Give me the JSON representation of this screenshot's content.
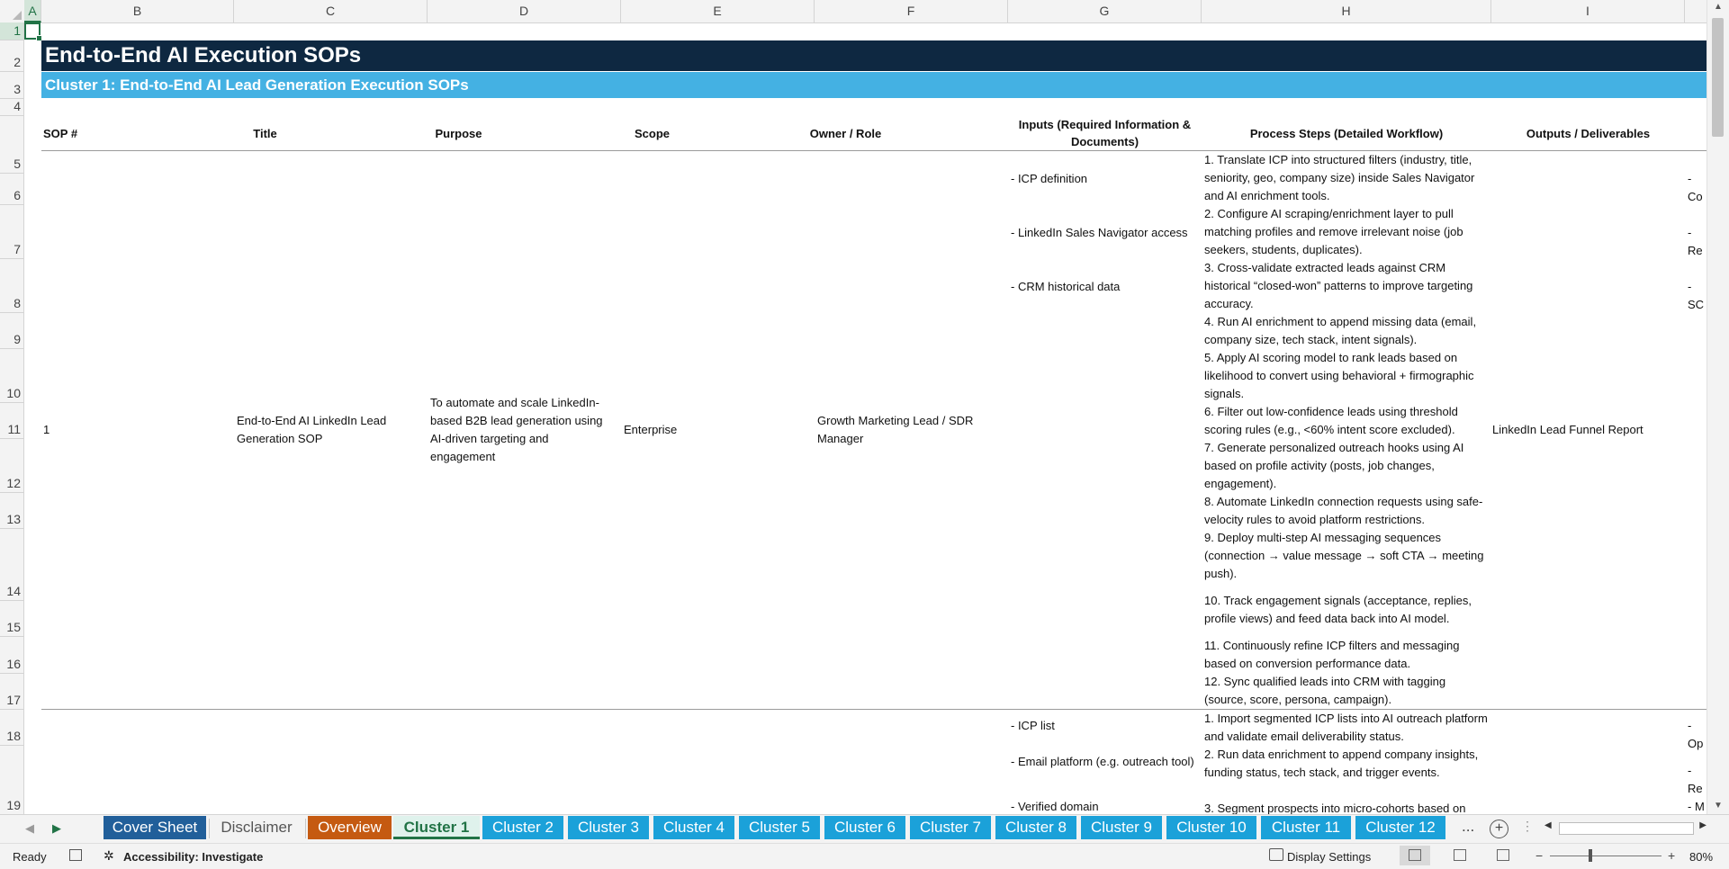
{
  "columns": [
    "A",
    "B",
    "C",
    "D",
    "E",
    "F",
    "G",
    "H",
    "I"
  ],
  "rows": [
    "1",
    "2",
    "3",
    "4",
    "5",
    "6",
    "7",
    "8",
    "9",
    "10",
    "11",
    "12",
    "13",
    "14",
    "15",
    "16",
    "17",
    "18",
    "19"
  ],
  "sheet": {
    "title": "End-to-End AI Execution SOPs",
    "subtitle": "Cluster 1: End-to-End AI Lead Generation Execution SOPs",
    "headers": {
      "sop": "SOP #",
      "title": "Title",
      "purpose": "Purpose",
      "scope": "Scope",
      "owner": "Owner / Role",
      "inputs": "Inputs (Required Information & Documents)",
      "process": "Process Steps (Detailed Workflow)",
      "outputs": "Outputs / Deliverables"
    },
    "record1": {
      "sop": "1",
      "title": "End-to-End AI LinkedIn Lead Generation SOP",
      "purpose": "To automate and scale LinkedIn-based B2B lead generation using AI-driven targeting and engagement",
      "scope": "Enterprise",
      "owner": "Growth Marketing Lead / SDR Manager",
      "inputs": [
        "- ICP definition",
        "- LinkedIn Sales Navigator access",
        "- CRM historical data"
      ],
      "steps": [
        "1. Translate ICP into structured filters (industry, title, seniority, geo, company size) inside Sales Navigator and AI enrichment tools.",
        "2. Configure AI scraping/enrichment layer to pull matching profiles and remove irrelevant noise (job seekers, students, duplicates).",
        "3. Cross-validate extracted leads against CRM historical “closed-won” patterns to improve targeting accuracy.",
        "4. Run AI enrichment to append missing data (email, company size, tech stack, intent signals).",
        "5. Apply AI scoring model to rank leads based on likelihood to convert using behavioral + firmographic signals.",
        "6. Filter out low-confidence leads using threshold scoring rules (e.g., <60% intent score excluded).",
        "7. Generate personalized outreach hooks using AI based on profile activity (posts, job changes, engagement).",
        "8. Automate LinkedIn connection requests using safe-velocity rules to avoid platform restrictions.",
        "9. Deploy multi-step AI messaging sequences (connection → value message → soft CTA → meeting push).",
        "10. Track engagement signals (acceptance, replies, profile views) and feed data back into AI model.",
        "11. Continuously refine ICP filters and messaging based on conversion performance data.",
        "12. Sync qualified leads into CRM with tagging (source, score, persona, campaign)."
      ],
      "output": "LinkedIn Lead Funnel Report",
      "side_clipped": [
        "- Co",
        "- Re",
        "- SC"
      ]
    },
    "record2": {
      "inputs": [
        "- ICP list",
        "- Email platform (e.g. outreach tool)",
        "- Verified domain"
      ],
      "steps": [
        "1. Import segmented ICP lists into AI outreach platform and validate email deliverability status.",
        "2. Run data enrichment to append company insights, funding status, tech stack, and trigger events.",
        "3. Segment prospects into micro-cohorts based on"
      ],
      "side_clipped": [
        "- Op",
        "- Re",
        "- M"
      ]
    }
  },
  "tabs": [
    {
      "label": "Cover Sheet",
      "color": "#215f9a"
    },
    {
      "label": "Disclaimer",
      "color": "#f3f3f3"
    },
    {
      "label": "Overview",
      "color": "#c55a11"
    },
    {
      "label": "Cluster 1",
      "color": "#dff2ec"
    },
    {
      "label": "Cluster 2",
      "color": "#1ba1d9"
    },
    {
      "label": "Cluster 3",
      "color": "#1ba1d9"
    },
    {
      "label": "Cluster 4",
      "color": "#1ba1d9"
    },
    {
      "label": "Cluster 5",
      "color": "#1ba1d9"
    },
    {
      "label": "Cluster 6",
      "color": "#1ba1d9"
    },
    {
      "label": "Cluster 7",
      "color": "#1ba1d9"
    },
    {
      "label": "Cluster 8",
      "color": "#1ba1d9"
    },
    {
      "label": "Cluster 9",
      "color": "#1ba1d9"
    },
    {
      "label": "Cluster 10",
      "color": "#1ba1d9"
    },
    {
      "label": "Cluster 11",
      "color": "#1ba1d9"
    },
    {
      "label": "Cluster 12",
      "color": "#1ba1d9"
    }
  ],
  "tabbar": {
    "more": "...",
    "add": "+"
  },
  "status": {
    "ready": "Ready",
    "accessibility": "Accessibility: Investigate",
    "display_settings": "Display Settings",
    "zoom": "80%",
    "zoom_minus": "−",
    "zoom_plus": "+"
  }
}
